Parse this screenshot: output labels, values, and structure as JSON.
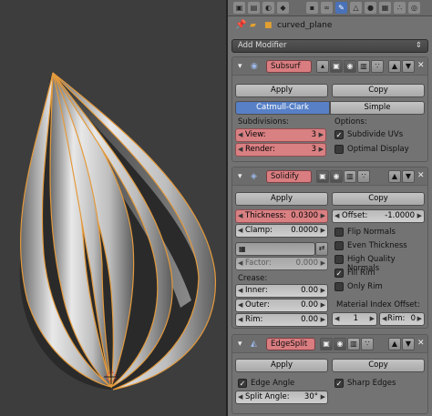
{
  "header": {
    "object_name": "curved_plane",
    "add_modifier_label": "Add Modifier"
  },
  "subsurf": {
    "name": "Subsurf",
    "apply_label": "Apply",
    "copy_label": "Copy",
    "mode_selected": "Catmull-Clark",
    "mode_other": "Simple",
    "subdivisions_heading": "Subdivisions:",
    "options_heading": "Options:",
    "view_label": "View:",
    "view_value": "3",
    "render_label": "Render:",
    "render_value": "3",
    "subdivide_uvs_label": "Subdivide UVs",
    "subdivide_uvs_checked": true,
    "optimal_display_label": "Optimal Display",
    "optimal_display_checked": false
  },
  "solidify": {
    "name": "Solidify",
    "apply_label": "Apply",
    "copy_label": "Copy",
    "thickness_label": "Thickness:",
    "thickness_value": "0.0300",
    "offset_label": "Offset:",
    "offset_value": "-1.0000",
    "clamp_label": "Clamp:",
    "clamp_value": "0.0000",
    "factor_label": "Factor:",
    "factor_value": "0.000",
    "flip_normals_label": "Flip Normals",
    "flip_normals_checked": false,
    "even_thickness_label": "Even Thickness",
    "even_thickness_checked": false,
    "high_quality_normals_label": "High Quality Normals",
    "high_quality_normals_checked": false,
    "fill_rim_label": "Fill Rim",
    "fill_rim_checked": true,
    "only_rim_label": "Only Rim",
    "only_rim_checked": false,
    "crease_heading": "Crease:",
    "inner_label": "Inner:",
    "inner_value": "0.00",
    "outer_label": "Outer:",
    "outer_value": "0.00",
    "rim_label": "Rim:",
    "rim_value": "0.00",
    "material_index_heading": "Material Index Offset:",
    "mat_value": "1",
    "mat_rim_label": "Rim:",
    "mat_rim_value": "0"
  },
  "edgesplit": {
    "name": "EdgeSplit",
    "apply_label": "Apply",
    "copy_label": "Copy",
    "edge_angle_label": "Edge Angle",
    "edge_angle_checked": true,
    "sharp_edges_label": "Sharp Edges",
    "sharp_edges_checked": true,
    "split_angle_label": "Split Angle:",
    "split_angle_value": "30°"
  },
  "icons": {
    "pin": "pin-icon",
    "object": "object-icon",
    "expand": "triangle-down-icon",
    "wrench": "wrench-icon",
    "close": "close-icon"
  },
  "colors": {
    "accent_blue": "#5780c7",
    "highlight_red": "#d98083",
    "viewport_bg": "#3d3d3d",
    "panel_bg": "#727272"
  }
}
